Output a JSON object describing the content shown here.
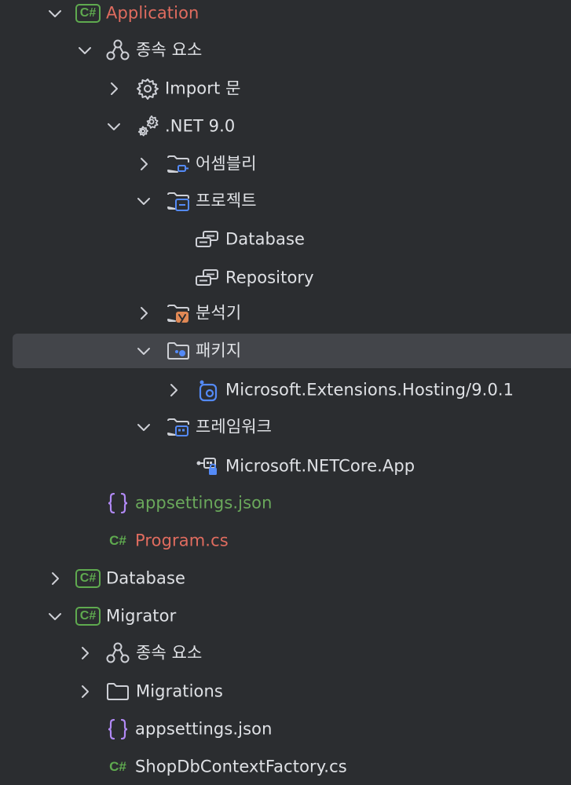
{
  "tree": {
    "application": {
      "label": "Application"
    },
    "app_dependencies": {
      "label": "종속 요소"
    },
    "import_statements": {
      "label": "Import 문"
    },
    "net_sdk": {
      "label": ".NET 9.0"
    },
    "assemblies": {
      "label": "어셈블리"
    },
    "projects": {
      "label": "프로젝트"
    },
    "project_database": {
      "label": "Database"
    },
    "project_repository": {
      "label": "Repository"
    },
    "analyzers": {
      "label": "분석기"
    },
    "packages": {
      "label": "패키지"
    },
    "package_hosting": {
      "label": "Microsoft.Extensions.Hosting/9.0.1"
    },
    "frameworks": {
      "label": "프레임워크"
    },
    "framework_netcore": {
      "label": "Microsoft.NETCore.App"
    },
    "app_appsettings": {
      "label": "appsettings.json"
    },
    "app_program": {
      "label": "Program.cs"
    },
    "database": {
      "label": "Database"
    },
    "migrator": {
      "label": "Migrator"
    },
    "migrator_dependencies": {
      "label": "종속 요소"
    },
    "migrations_folder": {
      "label": "Migrations"
    },
    "migrator_appsettings": {
      "label": "appsettings.json"
    },
    "shop_factory": {
      "label": "ShopDbContextFactory.cs"
    }
  },
  "badges": {
    "csharp_project": "C#",
    "csharp_file": "C#"
  },
  "icons": {
    "chevron_expanded": "chevron-down-icon",
    "chevron_collapsed": "chevron-right-icon",
    "project": "csharp-project-icon",
    "dependencies": "dependencies-icon",
    "imports": "gear-icon",
    "sdk": "gears-icon",
    "folder": "folder-icon",
    "reference": "project-reference-icon",
    "package": "nuget-package-icon",
    "framework": "framework-reference-icon",
    "json": "json-file-icon",
    "csharp_file": "csharp-file-icon"
  },
  "colors": {
    "background": "#2b2d30",
    "selection": "#43454a",
    "text": "#dfe1e5",
    "error_text": "#e06c5f",
    "modified_text": "#6aa85b",
    "csharp_green": "#5faa4f",
    "accent_blue": "#548af7",
    "analyzer_orange": "#e08855"
  }
}
